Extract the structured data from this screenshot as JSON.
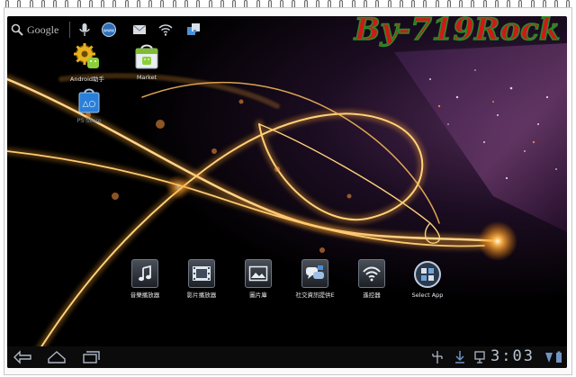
{
  "watermark": {
    "text": "By-719Rock"
  },
  "topbar": {
    "search_label": "Google",
    "icons": [
      "search-icon",
      "mic-icon",
      "browser-icon",
      "email-icon",
      "wifi-icon",
      "apps-icon"
    ]
  },
  "desktop": {
    "apps": [
      {
        "label": "Android助手",
        "icon": "android-assistant-icon"
      },
      {
        "label": "Market",
        "icon": "market-icon"
      },
      {
        "label": "PS Store",
        "icon": "ps-store-icon"
      }
    ]
  },
  "dock": {
    "apps": [
      {
        "label": "音樂播放器",
        "icon": "music-note-icon"
      },
      {
        "label": "影片播放器",
        "icon": "film-icon"
      },
      {
        "label": "圖片庫",
        "icon": "picture-icon"
      },
      {
        "label": "社交資訊提供E",
        "icon": "chat-bubbles-icon"
      },
      {
        "label": "遙控器",
        "icon": "wifi-signal-icon"
      },
      {
        "label": "Select App",
        "icon": "select-app-icon"
      }
    ]
  },
  "sysbar": {
    "clock": "3:03",
    "nav_icons": [
      "back-icon",
      "home-icon",
      "recent-apps-icon"
    ],
    "status_icons": [
      "usb-icon",
      "download-icon",
      "screenshot-icon"
    ]
  },
  "colors": {
    "watermark_red": "#d01818",
    "watermark_outline": "#2a8a2a",
    "glow": "#f5a030",
    "clock": "#b8c4d2"
  }
}
